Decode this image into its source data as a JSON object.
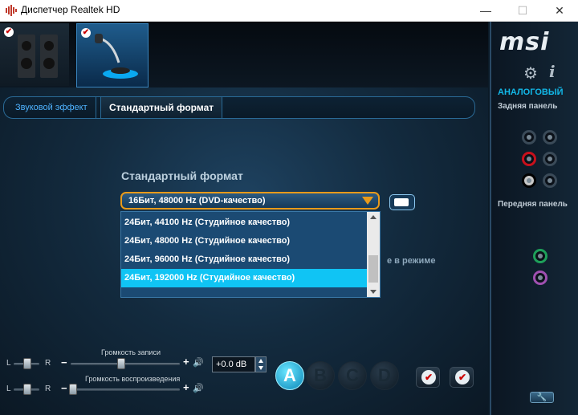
{
  "window": {
    "title": "Диспетчер Realtek HD",
    "minimize": "—",
    "maximize": "☐",
    "close": "✕"
  },
  "tabs": [
    {
      "label": "Звуковой эффект"
    },
    {
      "label": "Стандартный формат"
    }
  ],
  "format": {
    "section_title": "Стандартный формат",
    "selected": "16Бит, 48000 Hz (DVD-качество)",
    "options": [
      "24Бит, 44100 Hz (Студийное качество)",
      "24Бит, 48000 Hz (Студийное качество)",
      "24Бит, 96000 Hz (Студийное качество)",
      "24Бит, 192000 Hz (Студийное качество)"
    ],
    "highlighted_index": 3,
    "partial_text": "е в режиме"
  },
  "volume": {
    "record_label": "Громкость записи",
    "playback_label": "Громкость воспроизведения",
    "left": "L",
    "right": "R",
    "minus": "−",
    "plus": "+",
    "db_value": "+0.0 dB"
  },
  "buttons": {
    "a": "A",
    "b": "B",
    "c": "C",
    "d": "D",
    "check": "✔"
  },
  "right_panel": {
    "logo": "msi",
    "analog": "АНАЛОГОВЫЙ",
    "rear": "Задняя панель",
    "front": "Передняя панель",
    "wrench": "🔧"
  },
  "colors": {
    "accent": "#10c4f4",
    "dropdown_border": "#e89a1a",
    "jack_red": "#c8101c",
    "jack_green": "#1ea05a",
    "jack_pink": "#a050b0"
  }
}
